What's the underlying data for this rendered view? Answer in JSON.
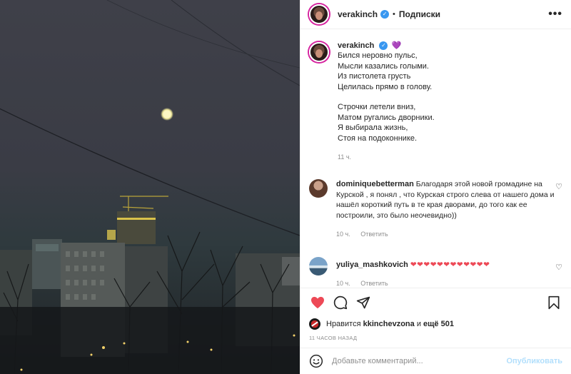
{
  "post": {
    "author": "verakinch",
    "follow_status": "Подписки",
    "more_label": "•••"
  },
  "caption": {
    "username": "verakinch",
    "emoji": "💜",
    "lines_stanza1": [
      "Бился неровно пульс,",
      "Мысли казались голыми.",
      "Из пистолета грусть",
      "Целилась прямо в голову."
    ],
    "lines_stanza2": [
      "Строчки летели вниз,",
      "Матом ругались дворники.",
      "Я выбирала жизнь,",
      "Стоя на подоконнике."
    ],
    "time": "11 ч."
  },
  "comments": [
    {
      "username": "dominiquebetterman",
      "text": "Благодаря этой новой громадине на Курской , я понял , что Курская строго слева от нашего дома и нашёл короткий путь в те края дворами, до того как ее построили, это было неочевидно))",
      "time": "10 ч.",
      "reply_label": "Ответить"
    },
    {
      "username": "yuliya_mashkovich",
      "text": "❤❤❤❤❤❤❤❤❤❤❤❤",
      "time": "10 ч.",
      "reply_label": "Ответить"
    }
  ],
  "likes": {
    "prefix": "Нравится",
    "user": "kkinchevzona",
    "connector": "и",
    "rest": "ещё 501"
  },
  "post_time": "11 ЧАСОВ НАЗАД",
  "comment_input": {
    "placeholder": "Добавьте комментарий...",
    "publish_label": "Опубликовать"
  },
  "icons": {
    "like": "heart-filled-icon",
    "comment": "comment-bubble-icon",
    "share": "paper-plane-icon",
    "save": "bookmark-icon",
    "emoji": "smiley-icon",
    "verified": "verified-badge-icon"
  },
  "colors": {
    "like_red": "#ed4956",
    "verified_blue": "#3897f0",
    "publish_disabled": "#b2dffc",
    "muted_text": "#8e8e8e"
  }
}
